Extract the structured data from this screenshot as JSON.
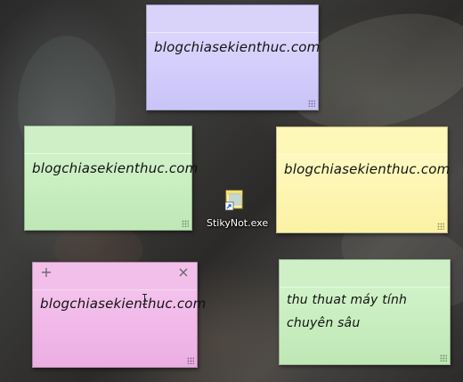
{
  "notes": [
    {
      "id": "purple",
      "text": "blogchiasekienthuc.com"
    },
    {
      "id": "green",
      "text": "blogchiasekienthuc.com"
    },
    {
      "id": "yellow",
      "text": "blogchiasekienthuc.com"
    },
    {
      "id": "pink",
      "text": "blogchiasekienthuc.com",
      "add_label": "+",
      "close_label": "×"
    },
    {
      "id": "green2",
      "line1": "thu thuat máy tính",
      "line2": "chuyên sâu"
    }
  ],
  "desktop_icon": {
    "label": "StikyNot.exe",
    "icon": "sticky-notes-shortcut-icon"
  },
  "colors": {
    "purple": "#d9d3fa",
    "green": "#cff0c7",
    "yellow": "#fdf7b8",
    "pink": "#f2bfeb"
  }
}
